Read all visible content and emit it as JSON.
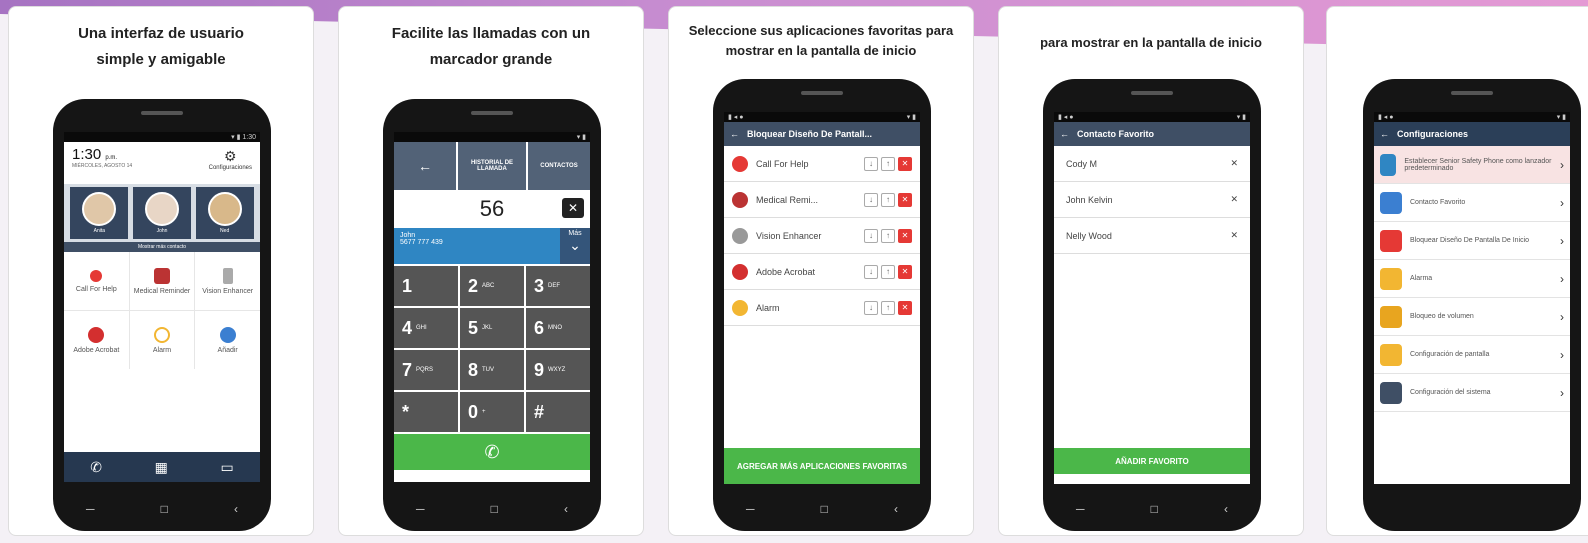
{
  "captions": [
    "Una interfaz de usuario\nsimple y amigable",
    "Facilite las llamadas con un\nmarcador grande",
    "Seleccione sus aplicaciones favoritas para\nmostrar en la pantalla de inicio",
    "para mostrar en la pantalla de inicio",
    ""
  ],
  "home": {
    "status": "1:30",
    "time": "1:30",
    "ampm": "p.m.",
    "date": "MIÉRCOLES, AGOSTO 14",
    "settings_label": "Configuraciones",
    "contacts": [
      "Anita",
      "John",
      "Ned"
    ],
    "show_more": "Mostrar más contacto",
    "apps": [
      "Call For Help",
      "Medical Reminder",
      "Vision Enhancer",
      "Adobe Acrobat",
      "Alarm",
      "Añadir"
    ]
  },
  "dialer": {
    "history": "HISTORIAL DE LLAMADA",
    "contacts": "CONTACTOS",
    "number": "56",
    "suggestion_name": "John",
    "suggestion_number": "5677 777 439",
    "more": "Más",
    "keys": [
      {
        "d": "1",
        "l": ""
      },
      {
        "d": "2",
        "l": "ABC"
      },
      {
        "d": "3",
        "l": "DEF"
      },
      {
        "d": "4",
        "l": "GHI"
      },
      {
        "d": "5",
        "l": "JKL"
      },
      {
        "d": "6",
        "l": "MNO"
      },
      {
        "d": "7",
        "l": "PQRS"
      },
      {
        "d": "8",
        "l": "TUV"
      },
      {
        "d": "9",
        "l": "WXYZ"
      },
      {
        "d": "*",
        "l": ""
      },
      {
        "d": "0",
        "l": "+"
      },
      {
        "d": "#",
        "l": ""
      }
    ]
  },
  "lock": {
    "title": "Bloquear Diseño De Pantall...",
    "items": [
      "Call For Help",
      "Medical Remi...",
      "Vision Enhancer",
      "Adobe Acrobat",
      "Alarm"
    ],
    "button": "AGREGAR MÁS APLICACIONES FAVORITAS"
  },
  "favorites": {
    "title": "Contacto Favorito",
    "items": [
      "Cody M",
      "John Kelvin",
      "Nelly Wood"
    ],
    "button": "AÑADIR FAVORITO"
  },
  "settings": {
    "title": "Configuraciones",
    "items": [
      "Establecer Senior Safety Phone como lanzador predeterminado",
      "Contacto Favorito",
      "Bloquear Diseño De Pantalla De Inicio",
      "Alarma",
      "Bloqueo de volumen",
      "Configuración de pantalla",
      "Configuración del sistema"
    ]
  },
  "colors": {
    "appbar": "#3f4f65",
    "green": "#4bb749",
    "red": "#e53935",
    "blue": "#2f86c3"
  }
}
